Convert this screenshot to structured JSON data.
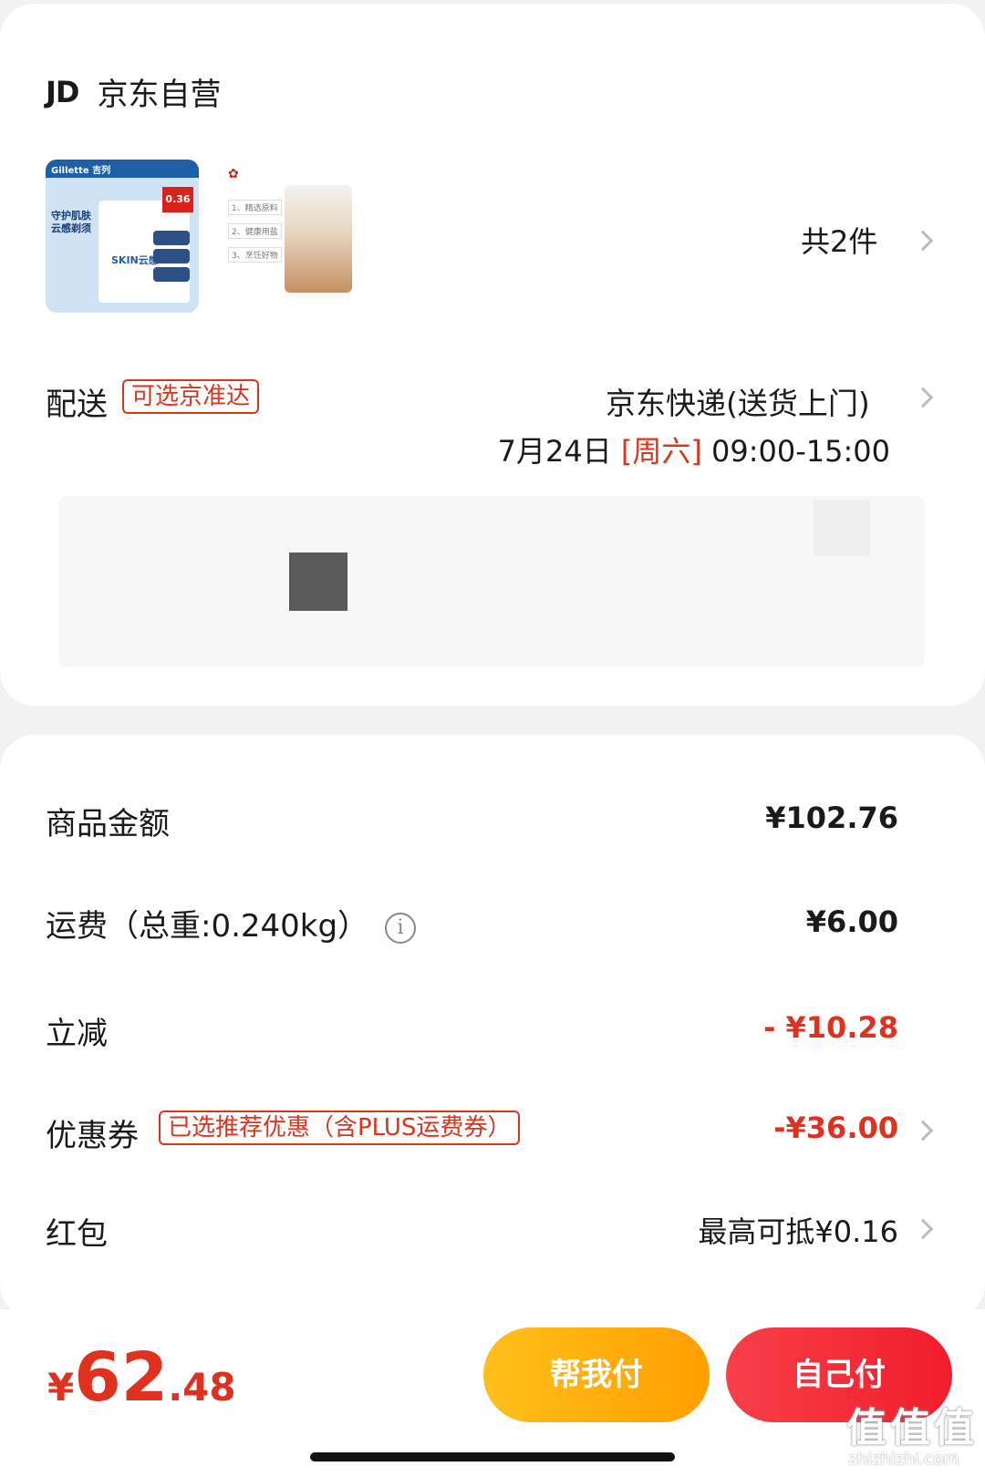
{
  "shop": {
    "logo": "JD",
    "name": "京东自营"
  },
  "products": {
    "count": "共2件",
    "item1": {
      "brand": "Gillette 吉列",
      "tagline": "守护肌肤 云感剃须",
      "model": "SKIN云感",
      "price_tag": "0.36元"
    },
    "item2": {
      "lines": [
        "1、精选原料",
        "2、健康用盐",
        "3、烹饪好物"
      ]
    }
  },
  "delivery": {
    "label": "配送",
    "tag": "可选京准达",
    "method": "京东快递(送货上门)",
    "date": "7月24日",
    "weekday": "[周六]",
    "time": "09:00-15:00"
  },
  "summary": {
    "goods_label": "商品金额",
    "goods_value": "¥102.76",
    "freight_label": "运费（总重:0.240kg）",
    "freight_value": "¥6.00",
    "discount_label": "立减",
    "discount_value": "- ¥10.28",
    "coupon_label": "优惠券",
    "coupon_tag": "已选推荐优惠（含PLUS运费券）",
    "coupon_value": "-¥36.00",
    "redpacket_label": "红包",
    "redpacket_value": "最高可抵¥0.16"
  },
  "footer": {
    "currency": "¥",
    "total_int": "62",
    "total_dec": ".48",
    "help_pay": "帮我付",
    "self_pay": "自己付"
  },
  "watermark": {
    "main": "值值值",
    "sub": "zhizhizhi.com"
  },
  "colors": {
    "accent_red": "#e0301e",
    "help_yellow": "#ffb30f",
    "self_red": "#f3263a"
  }
}
